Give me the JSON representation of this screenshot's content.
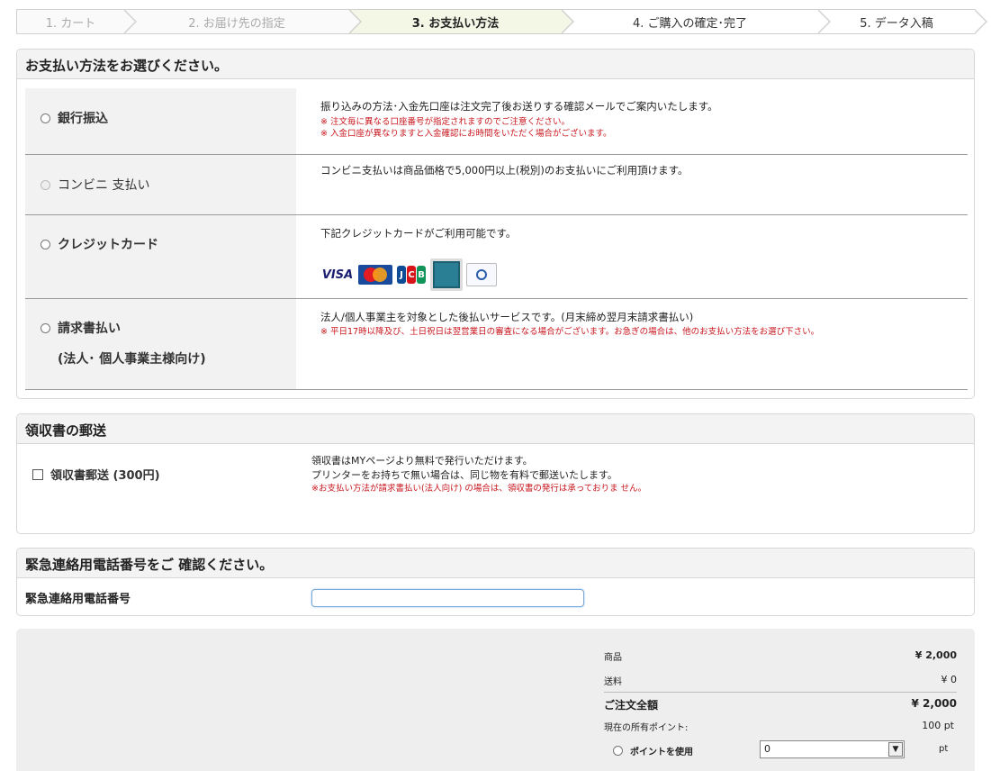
{
  "steps": [
    {
      "label": "1. カート"
    },
    {
      "label": "2. お届け先の指定"
    },
    {
      "label": "3. お支払い方法"
    },
    {
      "label": "4. ご購入の確定･完了"
    },
    {
      "label": "5. データ入稿"
    }
  ],
  "payment": {
    "heading": "お支払い方法をお選びください。",
    "bank": {
      "label": "銀行振込",
      "desc": "振り込みの方法･入金先口座は注文完了後お送りする確認メールでご案内いたします。",
      "note1": "※ 注文毎に異なる口座番号が指定されますのでご注意ください。",
      "note2": "※ 入金口座が異なりますと入金確認にお時間をいただく場合がございます。"
    },
    "convenience": {
      "label": "コンビニ 支払い",
      "desc": "コンビニ支払いは商品価格で5,000円以上(税別)のお支払いにご利用頂けます。"
    },
    "credit": {
      "label": "クレジットカード",
      "desc": "下記クレジットカードがご利用可能です。",
      "cards": {
        "visa": "VISA",
        "jcb": [
          "J",
          "C",
          "B"
        ]
      }
    },
    "invoice": {
      "label": "請求書払い",
      "sublabel": "(法人･ 個人事業主様向け)",
      "desc": "法人/個人事業主を対象とした後払いサービスです。(月末締め翌月末請求書払い)",
      "note": "※ 平日17時以降及び、土日祝日は翌営業日の審査になる場合がございます。お急ぎの場合は、他のお支払い方法をお選び下さい。"
    }
  },
  "receipt": {
    "heading": "領収書の郵送",
    "label": "領収書郵送 (300円)",
    "desc1": "領収書はMYページより無料で発行いただけます。",
    "desc2": "プリンターをお持ちで無い場合は、同じ物を有料で郵送いたします。",
    "note": "※お支払い方法が請求書払い(法人向け) の場合は、領収書の発行は承っておりま せん。"
  },
  "emergency": {
    "heading": "緊急連絡用電話番号をご 確認ください。",
    "label": "緊急連絡用電話番号",
    "value": ""
  },
  "summary": {
    "product_label": "商品",
    "product_value": "¥ 2,000",
    "shipping_label": "送料",
    "shipping_value": "¥ 0",
    "total_label": "ご注文全額",
    "total_value": "¥ 2,000",
    "points_label": "現在の所有ポイント:",
    "points_value": "100 pt",
    "use_points_label": "ポイントを使用",
    "select_value": "0",
    "pt_unit": "pt"
  },
  "colors": {
    "accent_step": "#f4f7e6",
    "note_red": "#c8161d",
    "border": "#d6d6d6"
  }
}
